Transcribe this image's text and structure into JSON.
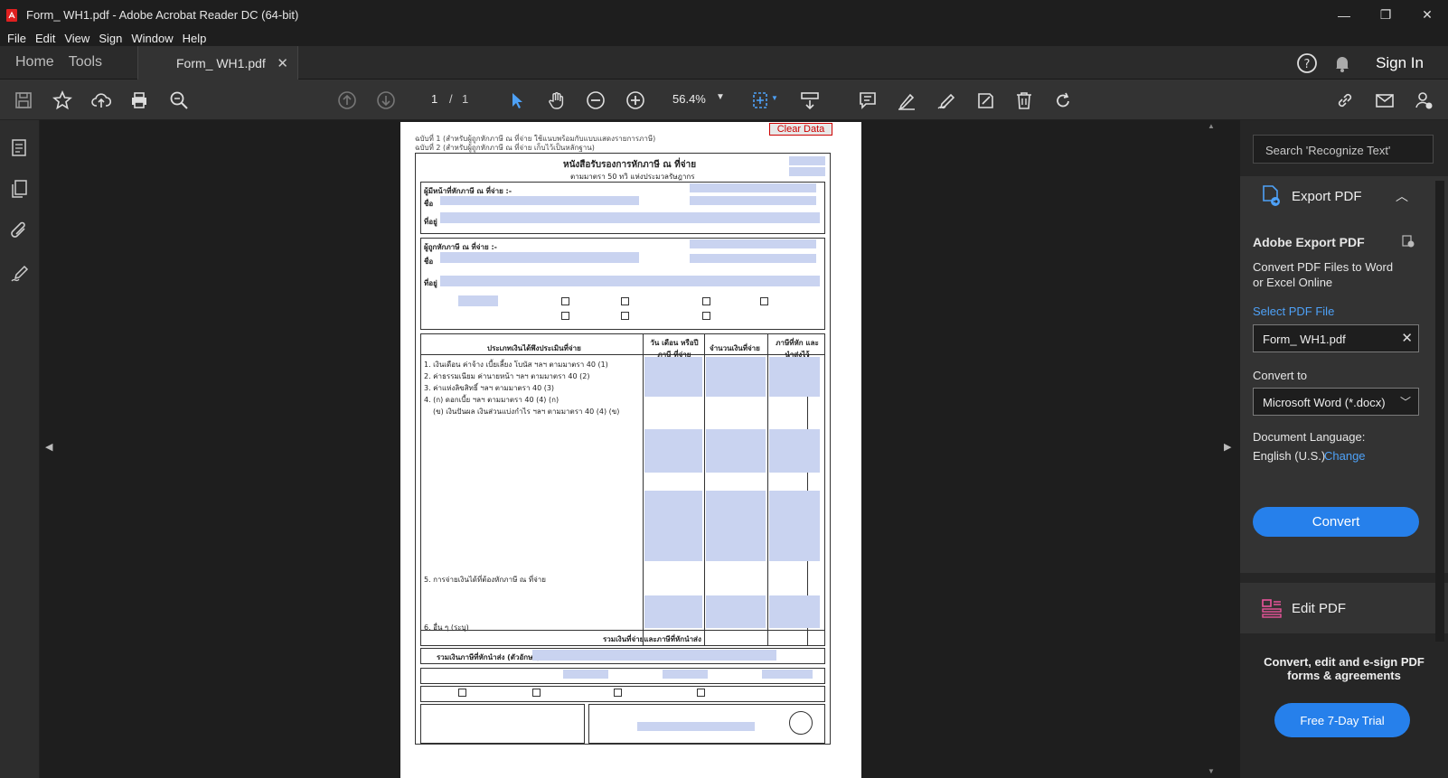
{
  "window": {
    "title": "Form_ WH1.pdf - Adobe Acrobat Reader DC (64-bit)",
    "controls": {
      "minimize": "—",
      "maximize": "❐",
      "close": "✕"
    }
  },
  "menu": [
    "File",
    "Edit",
    "View",
    "Sign",
    "Window",
    "Help"
  ],
  "tabs": {
    "home": "Home",
    "tools": "Tools",
    "document": "Form_ WH1.pdf",
    "sign_in": "Sign In"
  },
  "toolbar": {
    "page_current": "1",
    "page_sep": "/",
    "page_total": "1",
    "zoom": "56.4%"
  },
  "document": {
    "clear_data": "Clear Data",
    "form_title": "หนังสือรับรองการหักภาษี ณ ที่จ่าย",
    "form_subtitle": "ตามมาตรา 50 ทวิ แห่งประมวลรัษฎากร",
    "payer_label": "ผู้มีหน้าที่หักภาษี ณ ที่จ่าย :-",
    "payee_label": "ผู้ถูกหักภาษี ณ ที่จ่าย :-",
    "name_label": "ชื่อ",
    "address_label": "ที่อยู่",
    "table_col_type": "ประเภทเงินได้พึงประเมินที่จ่าย",
    "table_col_date": "วัน เดือน หรือปีภาษี ที่จ่าย",
    "table_col_amount": "จำนวนเงินที่จ่าย",
    "table_col_tax": "ภาษีที่หัก และนำส่งไว้",
    "total_label": "รวมเงินที่จ่ายและภาษีที่หักนำส่ง",
    "total_text_label": "รวมเงินภาษีที่หักนำส่ง (ตัวอักษร)",
    "income_rows": [
      "1. เงินเดือน ค่าจ้าง เบี้ยเลี้ยง โบนัส ฯลฯ ตามมาตรา 40 (1)",
      "2. ค่าธรรมเนียม ค่านายหน้า ฯลฯ ตามมาตรา 40 (2)",
      "3. ค่าแห่งลิขสิทธิ์ ฯลฯ ตามมาตรา 40 (3)",
      "4. (ก) ดอกเบี้ย ฯลฯ ตามมาตรา 40 (4) (ก)",
      "(ข) เงินปันผล เงินส่วนแบ่งกำไร ฯลฯ ตามมาตรา 40 (4) (ข)",
      "5. การจ่ายเงินได้ที่ต้องหักภาษี ณ ที่จ่าย",
      "6. อื่น ๆ (ระบุ)"
    ]
  },
  "right_panel": {
    "search_placeholder": "Search 'Recognize Text'",
    "export_title": "Export PDF",
    "adobe_export_title": "Adobe Export PDF",
    "export_desc_1": "Convert PDF Files to Word",
    "export_desc_2": "or Excel Online",
    "select_file": "Select PDF File",
    "file_name": "Form_ WH1.pdf",
    "convert_to_label": "Convert to",
    "convert_to_value": "Microsoft Word (*.docx)",
    "doc_lang_label": "Document Language:",
    "doc_lang_value": "English (U.S.)",
    "change_link": "Change",
    "convert_button": "Convert",
    "edit_pdf": "Edit PDF",
    "promo_line1": "Convert, edit and e-sign PDF",
    "promo_line2": "forms & agreements",
    "trial_button": "Free 7-Day Trial"
  },
  "colors": {
    "accent": "#2680eb",
    "link": "#4ea1f7",
    "export_icon": "#4ea1f7",
    "edit_icon": "#e8549a"
  }
}
